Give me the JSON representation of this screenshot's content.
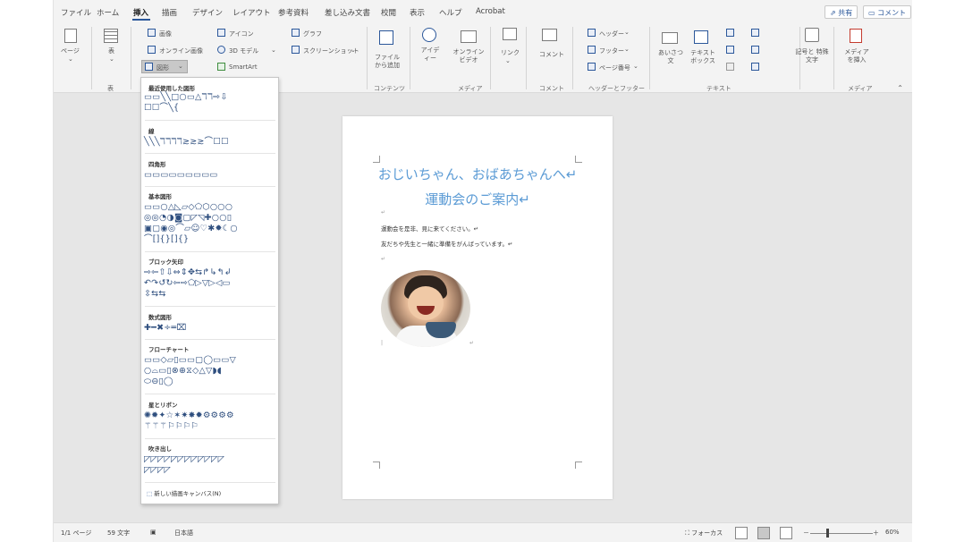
{
  "tabs": [
    "ファイル",
    "ホーム",
    "挿入",
    "描画",
    "デザイン",
    "レイアウト",
    "参考資料",
    "差し込み文書",
    "校閲",
    "表示",
    "ヘルプ",
    "Acrobat"
  ],
  "active_tab": "挿入",
  "share_label": "共有",
  "comment_label": "コメント",
  "ribbon": {
    "page_label": "ページ",
    "table_label": "表",
    "table_group": "表",
    "image": "画像",
    "online_image": "オンライン画像",
    "shapes": "図形",
    "icon": "アイコン",
    "model3d": "3D モデル",
    "smartart": "SmartArt",
    "chart": "グラフ",
    "screenshot": "スクリーンショット",
    "addin": "ファイルから追加",
    "content_group": "コンテンツ",
    "idea": "アイデ ィー",
    "online_video": "オンライン ビデオ",
    "media_group": "メディア",
    "link": "リンク",
    "comment": "コメント",
    "comment_group": "コメント",
    "header": "ヘッダー",
    "footer": "フッター",
    "page_number": "ページ番号",
    "hf_group": "ヘッダーとフッター",
    "greeting": "あいさつ 文",
    "textbox": "テキスト ボックス",
    "text_group": "テキスト",
    "symbol": "記号と 特殊文字",
    "insert_media": "メディア を挿入",
    "media_group2": "メディア"
  },
  "dropdown": {
    "recent": "最近使用した図形",
    "recent_rows": [
      "▭▭╲╲□○▭△ℸℸ⇨⇩",
      "☐☐⌒╲{"
    ],
    "lines": "線",
    "lines_rows": [
      "╲╲╲ℸℸℸℸ≳≳≳⌒☐☐"
    ],
    "rect": "四角形",
    "rect_rows": [
      "▭▭▭▭▭▭▭▭▭"
    ],
    "basic": "基本図形",
    "basic_rows": [
      "▭▭○△◺▱◇⬠⬡○○○",
      "◎◎◔◑◙▢◸◹✚○○▯",
      "▣▢◉◎⌒▱☺♡✱✹☾○",
      "⌒[]{}[]{}"
    ],
    "block": "ブロック矢印",
    "block_rows": [
      "⇨⇦⇧⇩⇔⇕✥⇆↱↳↰↲",
      "↶↷↺↻⇦⇨⬠▷▽▷◁▭",
      "⇳⇆⇆"
    ],
    "equation": "数式図形",
    "equation_rows": [
      "✚━✖÷═⌧"
    ],
    "flow": "フローチャート",
    "flow_rows": [
      "▭▭◇▱▯▭▭▢◯▭▭▽",
      "○⌓▭▯⊗⊕⧖◇△▽◗◖",
      "⬭⊖▯◯"
    ],
    "stars": "星とリボン",
    "stars_rows": [
      "✺✹✦☆✶✷✸✹⚙⚙⚙⚙",
      "⚚⚚⚚⚐⚐⚐⚐"
    ],
    "callouts": "吹き出し",
    "callouts_rows": [
      "◸◸◸◸◸◸◸◸◸◸◸◸",
      "◸◸◸◸"
    ],
    "canvas": "新しい描画キャンバス(N)"
  },
  "document": {
    "title1": "おじいちゃん、おばあちゃんへ↵",
    "title2": "運動会のご案内↵",
    "line1": "運動会を是非、見に来てください。↵",
    "line2": "友だちや先生と一緒に準備をがんばっています。↵",
    "mark": "↵"
  },
  "statusbar": {
    "page": "1/1 ページ",
    "words": "59 文字",
    "language": "日本語",
    "focus": "フォーカス",
    "zoom": "60%",
    "zoom_minus": "－",
    "zoom_plus": "＋"
  },
  "colors": {
    "accent": "#2b579a",
    "title_blue": "#5b9bd5"
  }
}
